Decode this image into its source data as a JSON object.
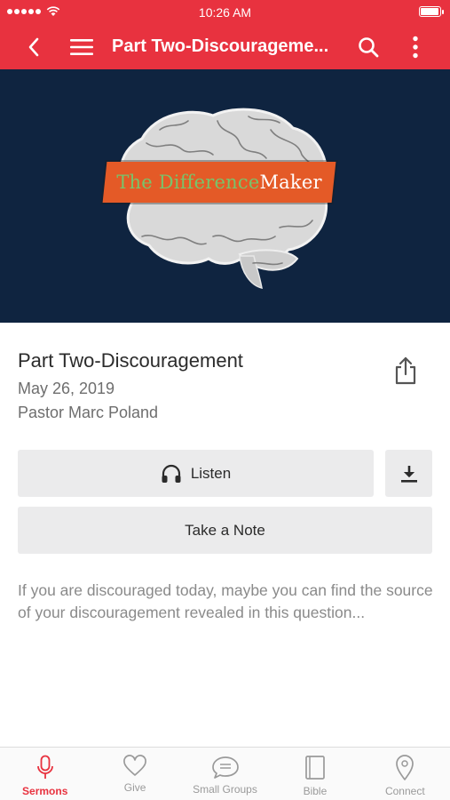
{
  "status_bar": {
    "time": "10:26 AM"
  },
  "app_bar": {
    "title": "Part Two-Discourageme..."
  },
  "hero": {
    "word1": "The Difference",
    "word2": "Maker"
  },
  "sermon": {
    "title": "Part Two-Discouragement",
    "date": "May 26, 2019",
    "speaker": "Pastor Marc Poland"
  },
  "actions": {
    "listen_label": "Listen",
    "note_label": "Take a Note"
  },
  "description": "If you are discouraged today, maybe you can find the source of your discouragement revealed in this question...",
  "tabs": [
    {
      "label": "Sermons",
      "icon": "microphone-icon",
      "active": true
    },
    {
      "label": "Give",
      "icon": "heart-icon",
      "active": false
    },
    {
      "label": "Small Groups",
      "icon": "chat-bubble-icon",
      "active": false
    },
    {
      "label": "Bible",
      "icon": "book-icon",
      "active": false
    },
    {
      "label": "Connect",
      "icon": "location-pin-icon",
      "active": false
    }
  ],
  "colors": {
    "brand_red": "#e8323f",
    "hero_bg": "#0f2440",
    "banner_orange": "#e45a27"
  }
}
